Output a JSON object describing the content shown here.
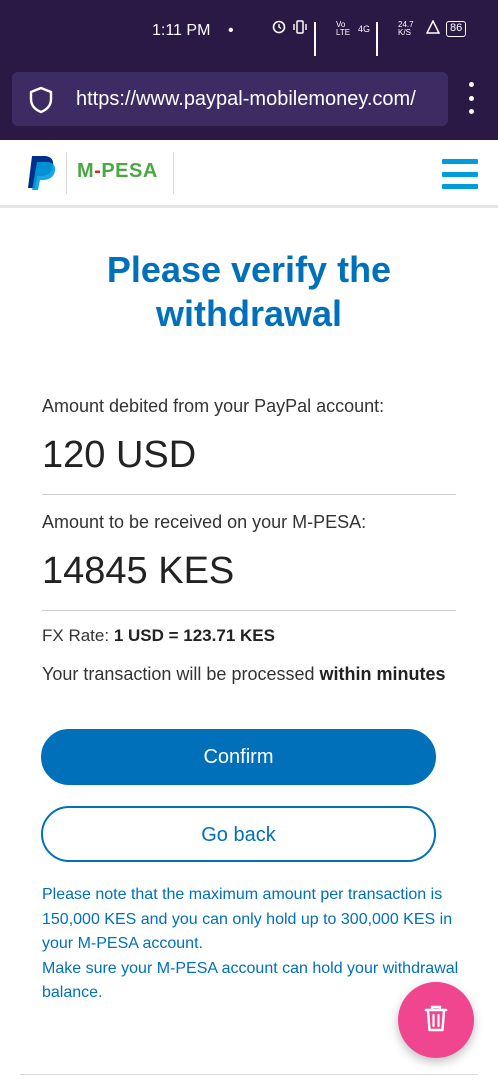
{
  "status_bar": {
    "time": "1:11 PM",
    "dot": "•",
    "vo_lte": "Vo LTE",
    "net_4g": "4G",
    "speed": "24.7 K/S",
    "battery": "86"
  },
  "browser": {
    "url": "https://www.paypal-mobilemoney.com/",
    "icons": [
      "shield-icon",
      "more-vert-icon"
    ]
  },
  "header": {
    "brand_paypal": "P",
    "brand_mpesa_left": "M",
    "brand_mpesa_dash": "-",
    "brand_mpesa_right": "PESA",
    "menu_icon": "hamburger-menu-icon",
    "colors": {
      "paypal_dark": "#003087",
      "paypal_light": "#009cde",
      "mpesa_green": "#4aa843",
      "mpesa_red": "#e2231a"
    }
  },
  "main": {
    "title": "Please verify the withdrawal",
    "debit_label": "Amount debited from your PayPal account:",
    "debit_amount": "120 USD",
    "receive_label": "Amount to be received on your M-PESA:",
    "receive_amount": "14845 KES",
    "fx_label": "FX Rate:",
    "fx_value": "1 USD = 123.71 KES",
    "processing_text": "Your transaction will be processed",
    "processing_bold": "within minutes",
    "confirm_label": "Confirm",
    "back_label": "Go back",
    "notice_1": "Please note that the maximum amount per transaction is 150,000 KES and you can only hold up to 300,000 KES in your M-PESA account.",
    "notice_2": "Make sure your M-PESA account can hold your withdrawal balance."
  },
  "fab": {
    "icon": "trash-icon",
    "color": "#f0468f"
  },
  "theme": {
    "accent": "#0070ba",
    "chrome_bg": "#2a1845"
  }
}
